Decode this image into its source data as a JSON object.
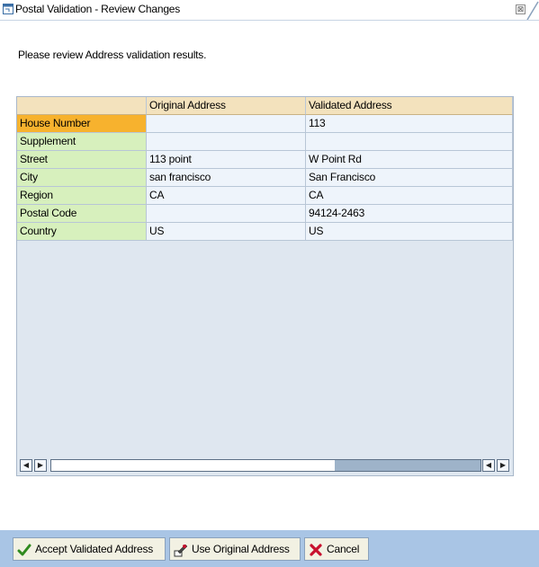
{
  "window": {
    "title": "Postal Validation - Review Changes",
    "close_glyph": "⊠"
  },
  "instruction": "Please review Address validation results.",
  "table": {
    "headers": [
      "",
      "Original Address",
      "Validated Address"
    ],
    "rows": [
      {
        "label": "House Number",
        "original": "",
        "validated": "113",
        "selected": true
      },
      {
        "label": "Supplement",
        "original": "",
        "validated": ""
      },
      {
        "label": "Street",
        "original": "113 point",
        "validated": "W Point Rd"
      },
      {
        "label": "City",
        "original": "san francisco",
        "validated": "San Francisco"
      },
      {
        "label": "Region",
        "original": "CA",
        "validated": "CA"
      },
      {
        "label": "Postal Code",
        "original": "",
        "validated": "94124-2463"
      },
      {
        "label": "Country",
        "original": "US",
        "validated": "US"
      }
    ]
  },
  "scrollbar": {
    "left_glyph": "◀",
    "right_glyph": "▶",
    "thumb_start_fraction": 0.66,
    "thumb_end_fraction": 1.0
  },
  "buttons": {
    "accept_label": "Accept Validated Address",
    "original_label": "Use Original Address",
    "cancel_label": "Cancel"
  },
  "colors": {
    "label_cell": "#d7f0bd",
    "selected_label_cell": "#f7b22e",
    "header": "#f3e2bd",
    "footer": "#a9c5e5",
    "accept_check": "#2f8a1f",
    "cancel_x": "#c8102e"
  },
  "icons": {
    "title": "window-icon",
    "accept": "checkmark-icon",
    "original": "edit-address-icon",
    "cancel": "cancel-x-icon"
  }
}
